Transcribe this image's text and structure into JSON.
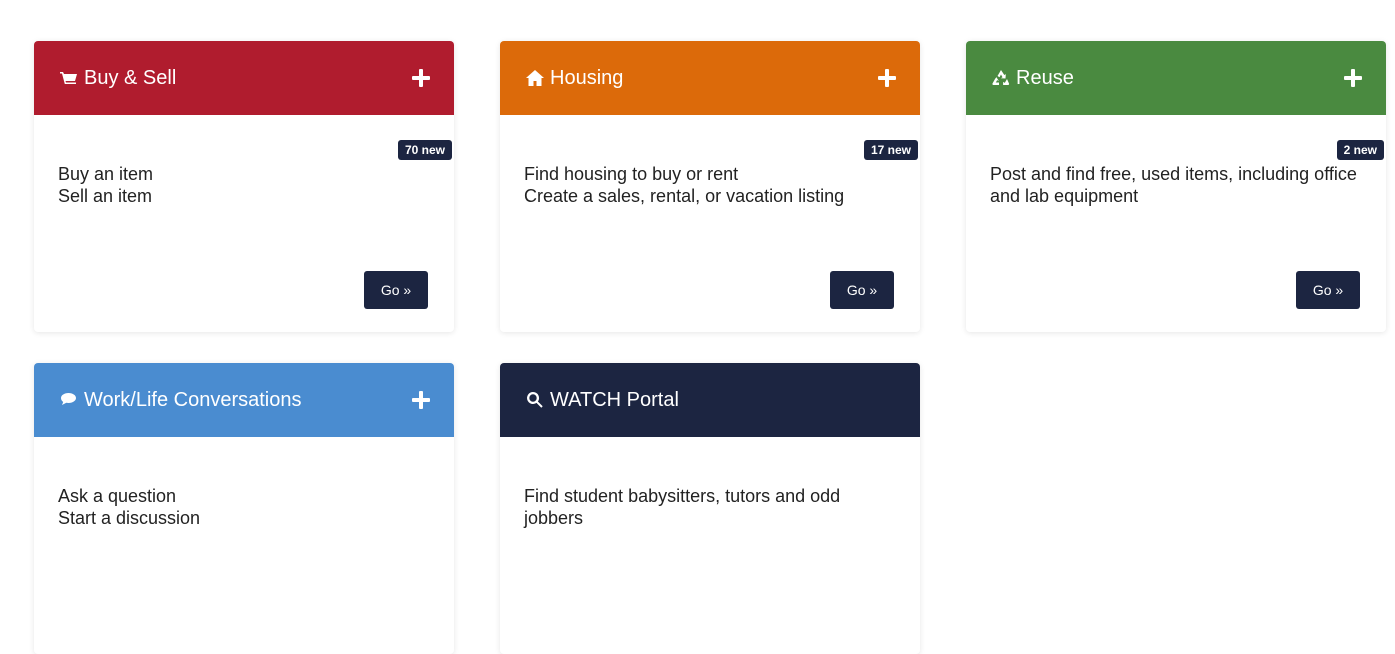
{
  "colors": {
    "buy_sell": "#b01c2e",
    "housing": "#dc6a0a",
    "reuse": "#4a8a40",
    "worklife": "#4a8cd0",
    "watch": "#1c2541",
    "dark": "#1c2541"
  },
  "cards": [
    {
      "title": "Buy & Sell",
      "icon": "cart-icon",
      "badge": "70 new",
      "lines": [
        "Buy an item",
        "Sell an item"
      ],
      "button": "Go »"
    },
    {
      "title": "Housing",
      "icon": "home-icon",
      "badge": "17 new",
      "lines": [
        "Find housing to buy or rent",
        "Create a sales, rental, or vacation listing"
      ],
      "button": "Go »"
    },
    {
      "title": "Reuse",
      "icon": "recycle-icon",
      "badge": "2 new",
      "lines": [
        "Post and find free, used items, including office and lab equipment"
      ],
      "button": "Go »"
    },
    {
      "title": "Work/Life Conversations",
      "icon": "chat-icon",
      "lines": [
        "Ask a question",
        "Start a discussion"
      ]
    },
    {
      "title": "WATCH Portal",
      "icon": "search-icon",
      "lines": [
        "Find student babysitters, tutors and odd jobbers"
      ]
    }
  ]
}
